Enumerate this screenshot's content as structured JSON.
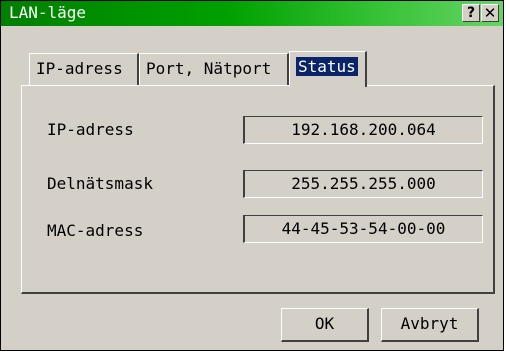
{
  "window": {
    "title": "LAN-läge",
    "help_label": "?",
    "close_label": "✕"
  },
  "tabs": [
    {
      "label": "IP-adress",
      "active": false
    },
    {
      "label": "Port, Nätport",
      "active": false
    },
    {
      "label": "Status",
      "active": true
    }
  ],
  "status": {
    "rows": [
      {
        "label": "IP-adress",
        "value": "192.168.200.064"
      },
      {
        "label": "Delnätsmask",
        "value": "255.255.255.000"
      },
      {
        "label": "MAC-adress",
        "value": "44-45-53-54-00-00"
      }
    ]
  },
  "buttons": {
    "ok_label": "OK",
    "cancel_label": "Avbryt"
  },
  "colors": {
    "titlebar_start": "#008000",
    "titlebar_end": "#66d466",
    "face": "#d4d0c8",
    "selection": "#0a246a"
  }
}
